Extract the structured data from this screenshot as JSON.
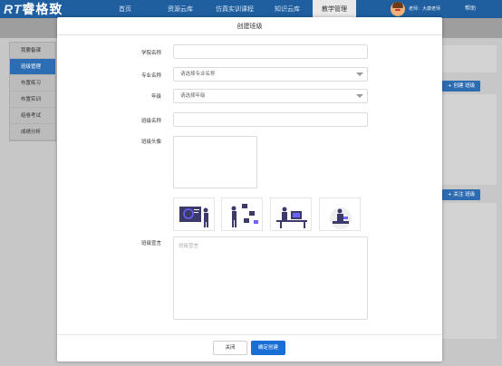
{
  "app": {
    "logo_mark": "RT",
    "logo_text": "睿格致"
  },
  "nav": {
    "items": [
      {
        "label": "首页"
      },
      {
        "label": "资源云库"
      },
      {
        "label": "仿真实训课程"
      },
      {
        "label": "知识云库"
      },
      {
        "label": "教学管理"
      }
    ],
    "active_index": 4,
    "user": "老师：大康老师",
    "help": "帮助"
  },
  "sidebar": {
    "items": [
      {
        "label": "我要备课"
      },
      {
        "label": "班级管理"
      },
      {
        "label": "布置练习"
      },
      {
        "label": "布置实训"
      },
      {
        "label": "组卷考试"
      },
      {
        "label": "成绩分析"
      }
    ],
    "active_index": 1
  },
  "background": {
    "create_class_btn": "+ 创建 班级",
    "follow_class_btn": "+ 关注 班级"
  },
  "modal": {
    "title": "创建班级",
    "fields": {
      "school": {
        "label": "学院名称",
        "value": ""
      },
      "major": {
        "label": "专业名称",
        "placeholder": "请选择专业名称"
      },
      "grade": {
        "label": "年级",
        "placeholder": "请选择年级"
      },
      "class_name": {
        "label": "班级名称",
        "value": ""
      },
      "class_avatar": {
        "label": "班级头像"
      },
      "declaration": {
        "label": "班级宣言",
        "placeholder": "班级宣言"
      }
    },
    "avatar_options": [
      {
        "icon": "presentation-illustration"
      },
      {
        "icon": "board-illustration"
      },
      {
        "icon": "desk-illustration"
      },
      {
        "icon": "reading-illustration"
      }
    ],
    "buttons": {
      "close": "关闭",
      "confirm": "确定创建"
    }
  },
  "colors": {
    "nav_bg": "#1f5f9f",
    "primary": "#1a6fd6",
    "illustration": "#3b3a6a"
  }
}
